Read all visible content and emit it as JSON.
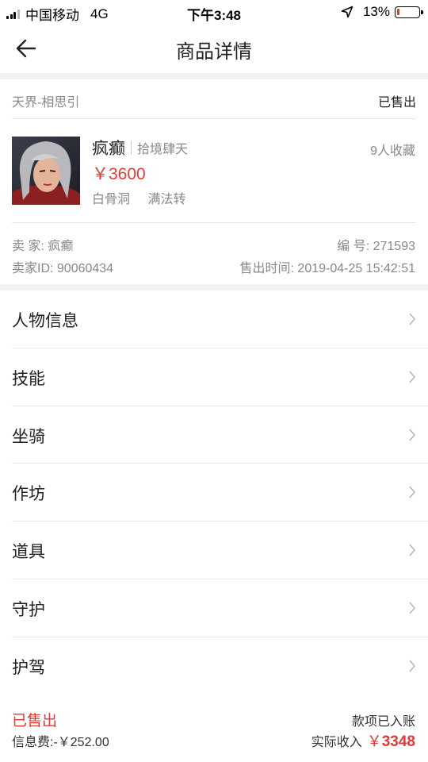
{
  "status_bar": {
    "carrier": "中国移动",
    "network": "4G",
    "time": "下午3:48",
    "battery": "13%",
    "battery_level": 0.13,
    "icons": [
      "signal-icon",
      "location-arrow-icon",
      "battery-icon"
    ]
  },
  "nav": {
    "title": "商品详情",
    "back_icon": "back-arrow-icon"
  },
  "goods": {
    "server": "天界-相思引",
    "status": "已售出",
    "name": "疯癫",
    "sect": "拾境肆天",
    "favorites": "9人收藏",
    "price": "￥3600",
    "tags": [
      "白骨洞",
      "满法转"
    ],
    "seller_label": "卖  家: 疯癫",
    "seller_id": "卖家ID: 90060434",
    "serial": "编  号: 271593",
    "sold_time": "售出时间: 2019-04-25 15:42:51"
  },
  "menu": {
    "items": [
      {
        "label": "人物信息"
      },
      {
        "label": "技能"
      },
      {
        "label": "坐骑"
      },
      {
        "label": "作坊"
      },
      {
        "label": "道具"
      },
      {
        "label": "守护"
      },
      {
        "label": "护驾"
      }
    ],
    "chevron_icon": "chevron-right-icon"
  },
  "footer": {
    "status": "已售出",
    "fee": "信息费:-￥252.00",
    "account_status": "款项已入账",
    "income_label": "实际收入",
    "income_currency": "￥",
    "income_value": "3348"
  },
  "colors": {
    "accent_red": "#e53935",
    "text_primary": "#222222",
    "text_secondary": "#888888",
    "divider": "#e6e6e6",
    "section_gap": "#f2f2f2"
  }
}
